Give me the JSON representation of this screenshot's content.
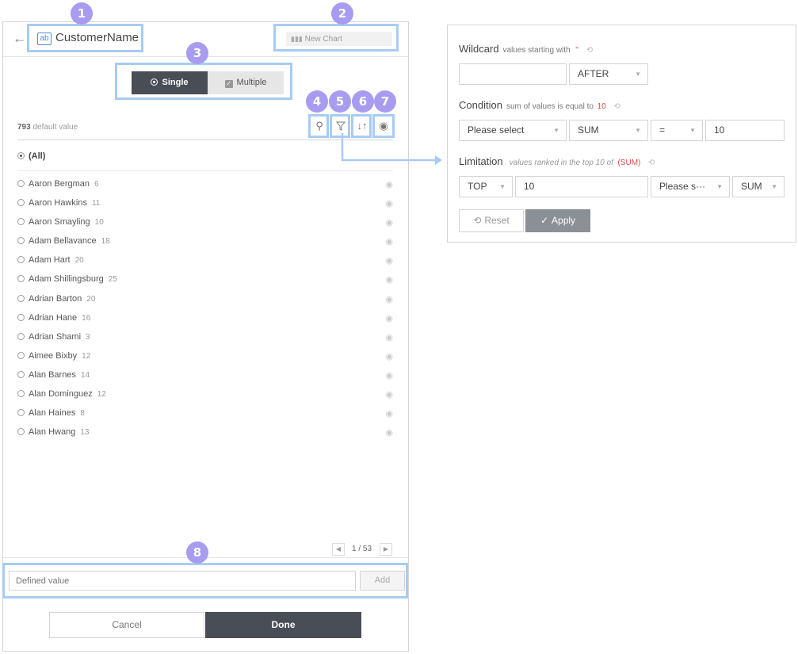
{
  "header": {
    "field_type_icon": "ab",
    "field_name": "CustomerName",
    "chart_name": "New Chart"
  },
  "mode": {
    "single_label": "Single",
    "multiple_label": "Multiple",
    "selected": "Single"
  },
  "list_info": {
    "count": "793",
    "count_label": "default value"
  },
  "tools": {
    "search": "search-icon",
    "filter": "filter-icon",
    "sort": "sort-icon",
    "visibility": "eye-icon"
  },
  "all_option": "(All)",
  "values": [
    {
      "name": "Aaron Bergman",
      "count": "6"
    },
    {
      "name": "Aaron Hawkins",
      "count": "11"
    },
    {
      "name": "Aaron Smayling",
      "count": "10"
    },
    {
      "name": "Adam Bellavance",
      "count": "18"
    },
    {
      "name": "Adam Hart",
      "count": "20"
    },
    {
      "name": "Adam Shillingsburg",
      "count": "25"
    },
    {
      "name": "Adrian Barton",
      "count": "20"
    },
    {
      "name": "Adrian Hane",
      "count": "16"
    },
    {
      "name": "Adrian Shami",
      "count": "3"
    },
    {
      "name": "Aimee Bixby",
      "count": "12"
    },
    {
      "name": "Alan Barnes",
      "count": "14"
    },
    {
      "name": "Alan Dominguez",
      "count": "12"
    },
    {
      "name": "Alan Haines",
      "count": "8"
    },
    {
      "name": "Alan Hwang",
      "count": "13"
    }
  ],
  "pager": {
    "text": "1 / 53"
  },
  "defined": {
    "placeholder": "Defined value",
    "add_label": "Add"
  },
  "footer": {
    "cancel_label": "Cancel",
    "done_label": "Done"
  },
  "callouts": [
    "1",
    "2",
    "3",
    "4",
    "5",
    "6",
    "7",
    "8"
  ],
  "filter_panel": {
    "wildcard": {
      "title": "Wildcard",
      "sub": "values starting with",
      "quote": "''",
      "input_value": "",
      "position_value": "AFTER"
    },
    "condition": {
      "title": "Condition",
      "sub": "sum of values is equal to",
      "value_highlight": "10",
      "field_value": "Please select",
      "aggregate_value": "SUM",
      "operator_value": "=",
      "input_value": "10"
    },
    "limitation": {
      "title": "Limitation",
      "sub": "values ranked in the top 10 of",
      "highlight": "(SUM)",
      "rank_value": "TOP",
      "count_value": "10",
      "field_value": "Please s···",
      "aggregate_value": "SUM"
    },
    "reset_label": "Reset",
    "apply_label": "Apply"
  },
  "colors": {
    "callout_badge": "#a89cf0",
    "callout_border": "#a7cbf4",
    "dark_button": "#494d56",
    "apply_button": "#8b9096",
    "accent_red": "#e04a4a"
  }
}
